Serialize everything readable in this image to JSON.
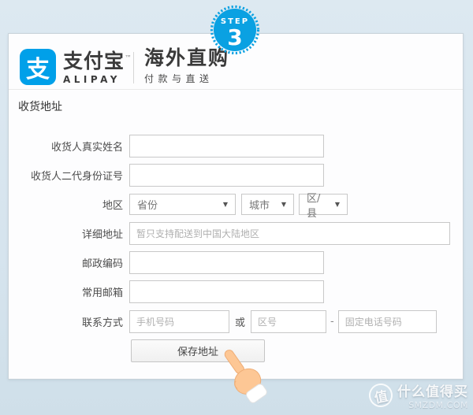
{
  "step_badge": {
    "label": "STEP",
    "number": "3",
    "color": "#0aa1e2"
  },
  "header": {
    "logo_char": "支",
    "brand_name": "支付宝",
    "trademark": "™",
    "brand_latin": "ALIPAY",
    "service_title": "海外直购",
    "service_tagline": "付款与直送"
  },
  "section_title": "收货地址",
  "form": {
    "name_label": "收货人真实姓名",
    "id_label": "收货人二代身份证号",
    "region_label": "地区",
    "province_placeholder": "省份",
    "city_placeholder": "城市",
    "district_placeholder": "区/县",
    "address_label": "详细地址",
    "address_placeholder": "暂只支持配送到中国大陆地区",
    "postcode_label": "邮政编码",
    "email_label": "常用邮箱",
    "contact_label": "联系方式",
    "mobile_placeholder": "手机号码",
    "or_text": "或",
    "areacode_placeholder": "区号",
    "phone_separator": "-",
    "landline_placeholder": "固定电话号码",
    "save_button_label": "保存地址"
  },
  "icons": {
    "dropdown_arrow": "▼"
  },
  "watermark": {
    "logo_char": "值",
    "site_name": "什么值得买",
    "site_domain": "SMZDM.COM"
  },
  "colors": {
    "alipay_blue": "#00a0e9",
    "badge_blue": "#0aa1e2",
    "page_background": "#d8e5ee"
  }
}
